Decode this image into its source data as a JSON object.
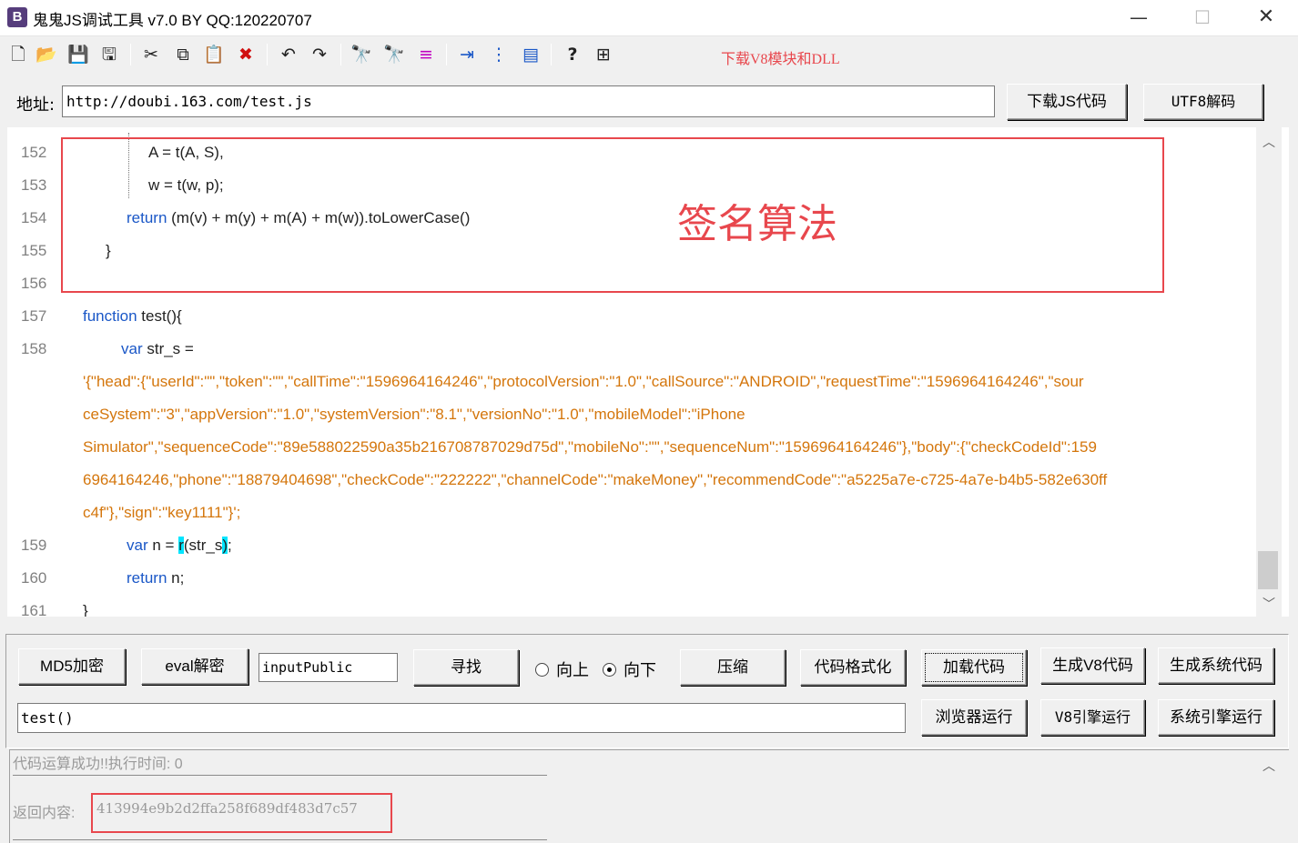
{
  "window": {
    "title": "鬼鬼JS调试工具 v7.0 BY QQ:120220707",
    "app_icon_letter": "B",
    "minimize": "—",
    "maximize": "☐",
    "close": "✕"
  },
  "toolbar": {
    "icons": [
      "new-file-icon",
      "open-folder-icon",
      "save-icon",
      "save-all-icon",
      "cut-icon",
      "copy-icon",
      "paste-icon",
      "delete-icon",
      "undo-icon",
      "redo-icon",
      "find-icon",
      "find-replace-icon",
      "indent-icon",
      "outdent-icon",
      "line-numbers-icon",
      "window-icon",
      "help-icon",
      "info-icon"
    ],
    "glyphs": [
      "🗋",
      "📂",
      "💾",
      "🖫",
      "✂",
      "⧉",
      "📋",
      "✖",
      "↶",
      "↷",
      "🔭",
      "🔭",
      "≡",
      "⇥",
      "⋮",
      "▤",
      "?",
      "⊞"
    ],
    "download_v8_link": "下载V8模块和DLL",
    "accent_color": "#e8474d"
  },
  "address": {
    "label": "地址:",
    "value": "http://doubi.163.com/test.js",
    "download_button": "下载JS代码",
    "utf8_button": "UTF8解码"
  },
  "editor": {
    "annotation": "签名算法",
    "lines": [
      {
        "num": "152",
        "pre": "A = t(A, S),"
      },
      {
        "num": "153",
        "pre": "w = t(w, p);"
      },
      {
        "num": "154",
        "kw": "return",
        "rest": " (m(v) + m(y) + m(A) + m(w)).toLowerCase()"
      },
      {
        "num": "155",
        "pre": "}"
      },
      {
        "num": "156",
        "pre": ""
      },
      {
        "num": "157",
        "kw": "function",
        "rest": " test(){"
      },
      {
        "num": "158",
        "kw": "var",
        "rest": " str_s ="
      },
      {
        "num": "",
        "str": "'{\"head\":{\"userId\":\"\",\"token\":\"\",\"callTime\":\"1596964164246\",\"protocolVersion\":\"1.0\",\"callSource\":\"ANDROID\",\"requestTime\":\"1596964164246\",\"sour"
      },
      {
        "num": "",
        "str": "ceSystem\":\"3\",\"appVersion\":\"1.0\",\"systemVersion\":\"8.1\",\"versionNo\":\"1.0\",\"mobileModel\":\"iPhone"
      },
      {
        "num": "",
        "str": "Simulator\",\"sequenceCode\":\"89e588022590a35b216708787029d75d\",\"mobileNo\":\"\",\"sequenceNum\":\"1596964164246\"},\"body\":{\"checkCodeId\":159"
      },
      {
        "num": "",
        "str": "6964164246,\"phone\":\"18879404698\",\"checkCode\":\"222222\",\"channelCode\":\"makeMoney\",\"recommendCode\":\"a5225a7e-c725-4a7e-b4b5-582e630ff"
      },
      {
        "num": "",
        "str": "c4f\"},\"sign\":\"key1111\"}';"
      },
      {
        "num": "159",
        "kw": "var",
        "rest1": " n = ",
        "m1": "r",
        "rest2": "(str_s",
        "m2": ")",
        "rest3": ";"
      },
      {
        "num": "160",
        "kw": "return",
        "rest": " n;"
      },
      {
        "num": "161",
        "pre": "}"
      }
    ]
  },
  "controls": {
    "md5_button": "MD5加密",
    "eval_button": "eval解密",
    "search_value": "inputPublic",
    "find_button": "寻找",
    "radio_up": "向上",
    "radio_down": "向下",
    "selected_direction": "向下",
    "compress_button": "压缩",
    "format_button": "代码格式化",
    "load_button": "加载代码",
    "gen_v8_button": "生成V8代码",
    "gen_sys_button": "生成系统代码",
    "command_value": "test()",
    "browser_run_button": "浏览器运行",
    "v8_run_button": "V8引擎运行",
    "sys_run_button": "系统引擎运行"
  },
  "output": {
    "status": "代码运算成功!!执行时间: 0",
    "return_label": "返回内容:",
    "return_value": "413994e9b2d2ffa258f689df483d7c57"
  }
}
